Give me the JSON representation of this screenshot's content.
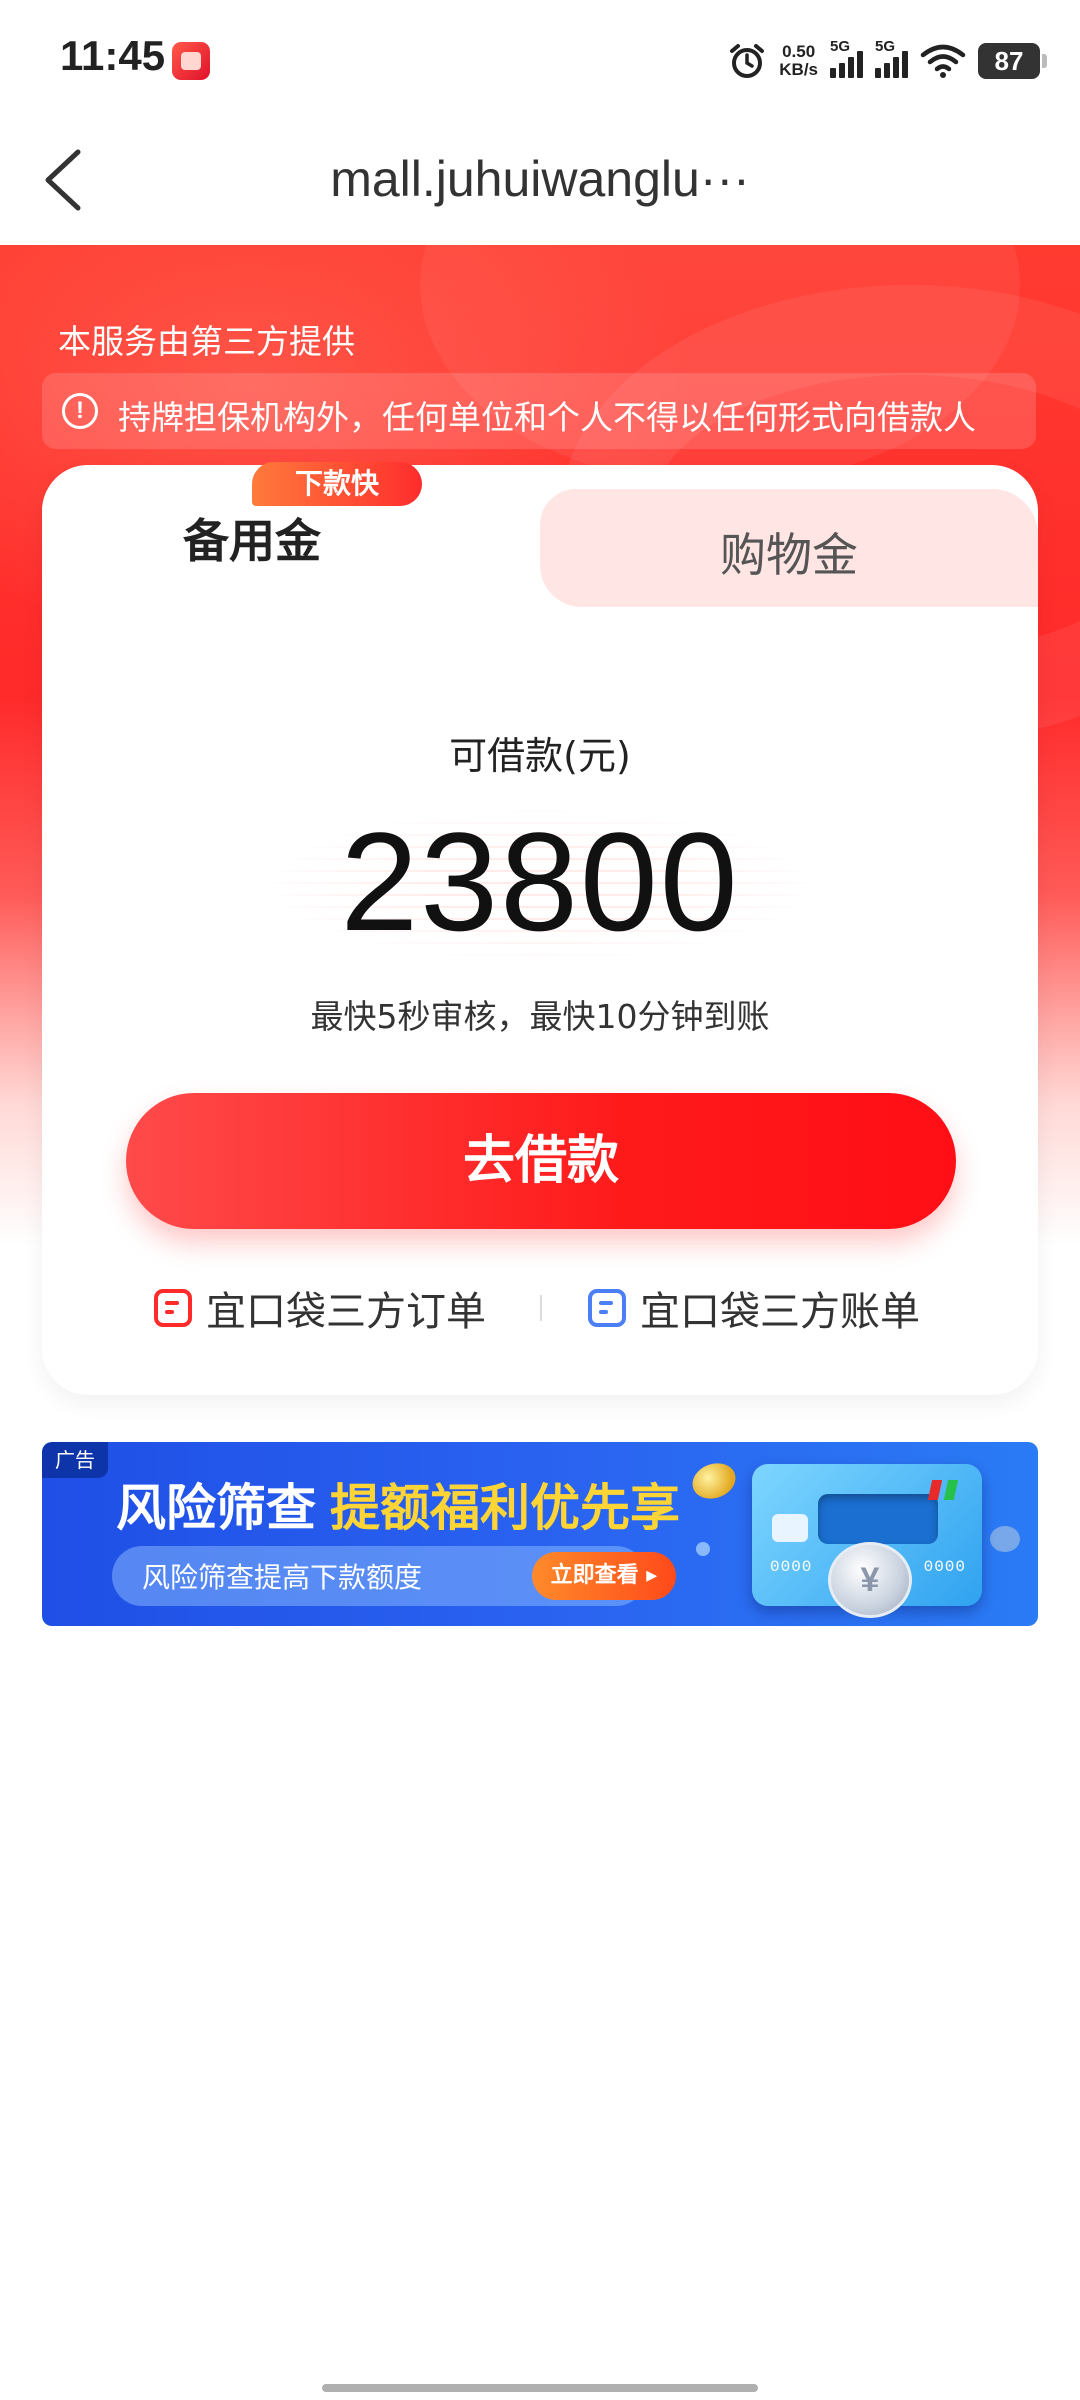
{
  "status_bar": {
    "time": "11:45",
    "net_speed_value": "0.50",
    "net_speed_unit": "KB/s",
    "sim1_label": "5G",
    "sim2_label": "5G",
    "battery_level": "87"
  },
  "nav": {
    "title": "mall.juhuiwanglu···"
  },
  "hero": {
    "provider_text": "本服务由第三方提供",
    "notice_icon": "!",
    "notice_text": "持牌担保机构外，任何单位和个人不得以任何形式向借款人"
  },
  "tabs": [
    {
      "label": "备用金",
      "badge": "下款快",
      "active": true
    },
    {
      "label": "购物金",
      "active": false
    }
  ],
  "loan": {
    "amount_label": "可借款(元)",
    "amount": "23800",
    "subtitle": "最快5秒审核，最快10分钟到账",
    "button_label": "去借款"
  },
  "links": [
    {
      "label": "宜口袋三方订单",
      "icon": "order-doc-icon",
      "color": "#ff2b2b"
    },
    {
      "label": "宜口袋三方账单",
      "icon": "bill-doc-icon",
      "color": "#4c7ff5"
    }
  ],
  "ad": {
    "tag": "广告",
    "headline_white": "风险筛查",
    "headline_yellow": "提额福利优先享",
    "pill_text": "风险筛查提高下款额度",
    "cta": "立即查看 ▸",
    "card_digits_left": "0000",
    "card_digits_right": "0000",
    "coin_symbol": "¥"
  },
  "colors": {
    "brand_red": "#ff2a2a",
    "tab_inactive_bg": "#ffe5e4",
    "ad_blue": "#2a62f0",
    "ad_yellow": "#ffd535"
  }
}
